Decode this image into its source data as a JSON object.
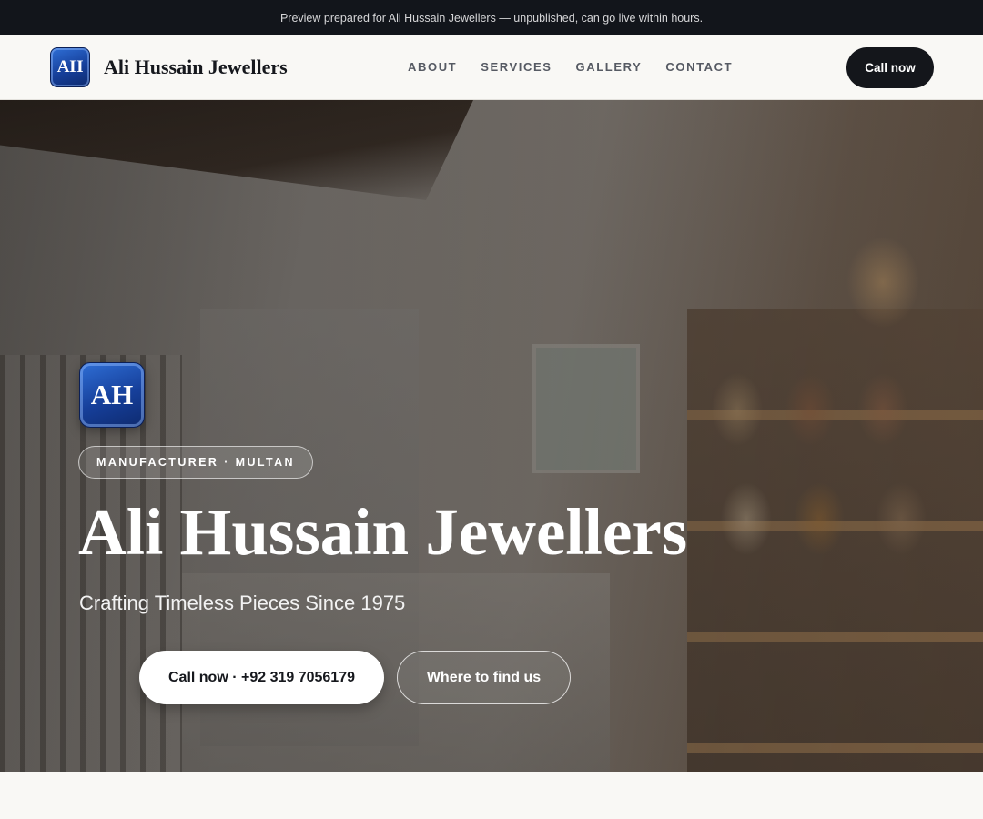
{
  "preview_banner": {
    "text": "Preview prepared for Ali Hussain Jewellers — unpublished, can go live within hours."
  },
  "navbar": {
    "logo_text": "AH",
    "brand_name": "Ali Hussain Jewellers",
    "links": [
      "ABOUT",
      "SERVICES",
      "GALLERY",
      "CONTACT"
    ],
    "call_label": "Call now"
  },
  "hero": {
    "logo_text": "AH",
    "badge": "MANUFACTURER · MULTAN",
    "title": "Ali Hussain Jewellers",
    "subtitle": "Crafting Timeless Pieces Since 1975",
    "call_button": "Call now · +92 319 7056179",
    "find_button": "Where to find us"
  },
  "colors": {
    "top_banner_bg": "#12151b",
    "page_bg": "#f9f8f5",
    "nav_button_bg": "#14161b",
    "logo_blue": "#163f9a"
  }
}
